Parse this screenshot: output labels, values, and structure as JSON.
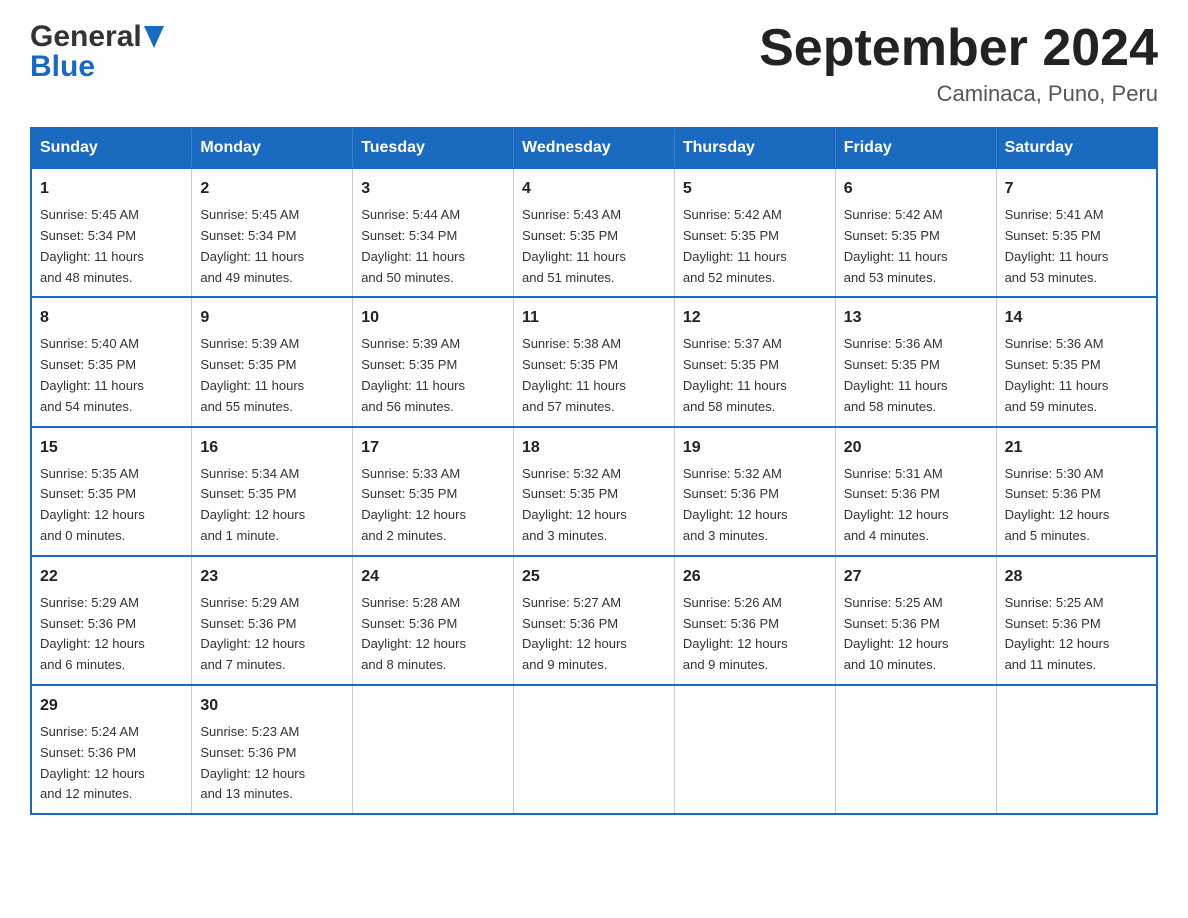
{
  "header": {
    "logo_general": "General",
    "logo_blue": "Blue",
    "month_title": "September 2024",
    "location": "Caminaca, Puno, Peru"
  },
  "days_of_week": [
    "Sunday",
    "Monday",
    "Tuesday",
    "Wednesday",
    "Thursday",
    "Friday",
    "Saturday"
  ],
  "weeks": [
    [
      {
        "day": "1",
        "sunrise": "5:45 AM",
        "sunset": "5:34 PM",
        "daylight": "11 hours and 48 minutes."
      },
      {
        "day": "2",
        "sunrise": "5:45 AM",
        "sunset": "5:34 PM",
        "daylight": "11 hours and 49 minutes."
      },
      {
        "day": "3",
        "sunrise": "5:44 AM",
        "sunset": "5:34 PM",
        "daylight": "11 hours and 50 minutes."
      },
      {
        "day": "4",
        "sunrise": "5:43 AM",
        "sunset": "5:35 PM",
        "daylight": "11 hours and 51 minutes."
      },
      {
        "day": "5",
        "sunrise": "5:42 AM",
        "sunset": "5:35 PM",
        "daylight": "11 hours and 52 minutes."
      },
      {
        "day": "6",
        "sunrise": "5:42 AM",
        "sunset": "5:35 PM",
        "daylight": "11 hours and 53 minutes."
      },
      {
        "day": "7",
        "sunrise": "5:41 AM",
        "sunset": "5:35 PM",
        "daylight": "11 hours and 53 minutes."
      }
    ],
    [
      {
        "day": "8",
        "sunrise": "5:40 AM",
        "sunset": "5:35 PM",
        "daylight": "11 hours and 54 minutes."
      },
      {
        "day": "9",
        "sunrise": "5:39 AM",
        "sunset": "5:35 PM",
        "daylight": "11 hours and 55 minutes."
      },
      {
        "day": "10",
        "sunrise": "5:39 AM",
        "sunset": "5:35 PM",
        "daylight": "11 hours and 56 minutes."
      },
      {
        "day": "11",
        "sunrise": "5:38 AM",
        "sunset": "5:35 PM",
        "daylight": "11 hours and 57 minutes."
      },
      {
        "day": "12",
        "sunrise": "5:37 AM",
        "sunset": "5:35 PM",
        "daylight": "11 hours and 58 minutes."
      },
      {
        "day": "13",
        "sunrise": "5:36 AM",
        "sunset": "5:35 PM",
        "daylight": "11 hours and 58 minutes."
      },
      {
        "day": "14",
        "sunrise": "5:36 AM",
        "sunset": "5:35 PM",
        "daylight": "11 hours and 59 minutes."
      }
    ],
    [
      {
        "day": "15",
        "sunrise": "5:35 AM",
        "sunset": "5:35 PM",
        "daylight": "12 hours and 0 minutes."
      },
      {
        "day": "16",
        "sunrise": "5:34 AM",
        "sunset": "5:35 PM",
        "daylight": "12 hours and 1 minute."
      },
      {
        "day": "17",
        "sunrise": "5:33 AM",
        "sunset": "5:35 PM",
        "daylight": "12 hours and 2 minutes."
      },
      {
        "day": "18",
        "sunrise": "5:32 AM",
        "sunset": "5:35 PM",
        "daylight": "12 hours and 3 minutes."
      },
      {
        "day": "19",
        "sunrise": "5:32 AM",
        "sunset": "5:36 PM",
        "daylight": "12 hours and 3 minutes."
      },
      {
        "day": "20",
        "sunrise": "5:31 AM",
        "sunset": "5:36 PM",
        "daylight": "12 hours and 4 minutes."
      },
      {
        "day": "21",
        "sunrise": "5:30 AM",
        "sunset": "5:36 PM",
        "daylight": "12 hours and 5 minutes."
      }
    ],
    [
      {
        "day": "22",
        "sunrise": "5:29 AM",
        "sunset": "5:36 PM",
        "daylight": "12 hours and 6 minutes."
      },
      {
        "day": "23",
        "sunrise": "5:29 AM",
        "sunset": "5:36 PM",
        "daylight": "12 hours and 7 minutes."
      },
      {
        "day": "24",
        "sunrise": "5:28 AM",
        "sunset": "5:36 PM",
        "daylight": "12 hours and 8 minutes."
      },
      {
        "day": "25",
        "sunrise": "5:27 AM",
        "sunset": "5:36 PM",
        "daylight": "12 hours and 9 minutes."
      },
      {
        "day": "26",
        "sunrise": "5:26 AM",
        "sunset": "5:36 PM",
        "daylight": "12 hours and 9 minutes."
      },
      {
        "day": "27",
        "sunrise": "5:25 AM",
        "sunset": "5:36 PM",
        "daylight": "12 hours and 10 minutes."
      },
      {
        "day": "28",
        "sunrise": "5:25 AM",
        "sunset": "5:36 PM",
        "daylight": "12 hours and 11 minutes."
      }
    ],
    [
      {
        "day": "29",
        "sunrise": "5:24 AM",
        "sunset": "5:36 PM",
        "daylight": "12 hours and 12 minutes."
      },
      {
        "day": "30",
        "sunrise": "5:23 AM",
        "sunset": "5:36 PM",
        "daylight": "12 hours and 13 minutes."
      },
      null,
      null,
      null,
      null,
      null
    ]
  ]
}
